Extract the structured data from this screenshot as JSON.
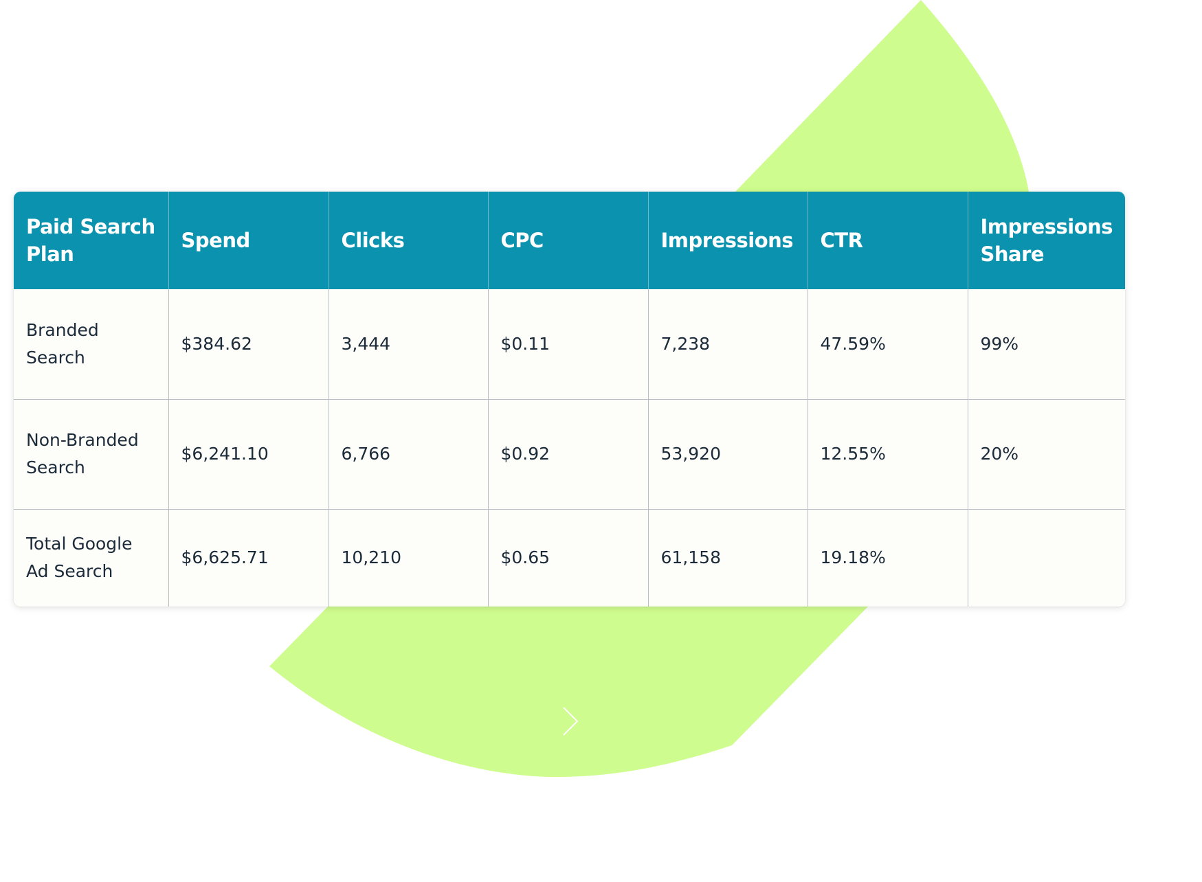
{
  "colors": {
    "header_bg": "#0b92ae",
    "header_text": "#ffffff",
    "body_bg": "#fdfdf9",
    "body_text": "#1c2b3a",
    "grid_line": "#b8bfc4",
    "accent_shape": "#cffc8e"
  },
  "icons": {
    "chevron": "chevron-right-icon"
  },
  "table": {
    "headers": [
      "Paid Search Plan",
      "Spend",
      "Clicks",
      "CPC",
      "Impressions",
      "CTR",
      "Impressions Share"
    ],
    "rows": [
      [
        "Branded Search",
        "$384.62",
        "3,444",
        "$0.11",
        "7,238",
        "47.59%",
        "99%"
      ],
      [
        "Non-Branded Search",
        "$6,241.10",
        "6,766",
        "$0.92",
        "53,920",
        "12.55%",
        "20%"
      ],
      [
        "Total Google Ad Search",
        "$6,625.71",
        "10,210",
        "$0.65",
        "61,158",
        "19.18%",
        ""
      ]
    ]
  }
}
